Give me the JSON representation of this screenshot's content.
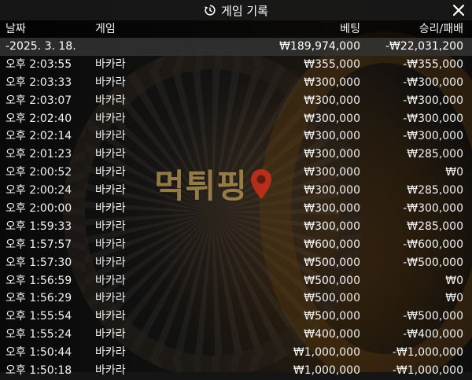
{
  "header": {
    "title": "게임 기록",
    "close_label": "✕"
  },
  "columns": {
    "date": "날짜",
    "game": "게임",
    "bet": "베팅",
    "win_loss": "승리/패배"
  },
  "summary": {
    "date": "-2025. 3. 18.",
    "bet": "₩189,974,000",
    "win_loss": "-₩22,031,200"
  },
  "rows": [
    {
      "time": "오후 2:03:55",
      "game": "바카라",
      "bet": "₩355,000",
      "win_loss": "-₩355,000"
    },
    {
      "time": "오후 2:03:33",
      "game": "바카라",
      "bet": "₩300,000",
      "win_loss": "-₩300,000"
    },
    {
      "time": "오후 2:03:07",
      "game": "바카라",
      "bet": "₩300,000",
      "win_loss": "-₩300,000"
    },
    {
      "time": "오후 2:02:40",
      "game": "바카라",
      "bet": "₩300,000",
      "win_loss": "-₩300,000"
    },
    {
      "time": "오후 2:02:14",
      "game": "바카라",
      "bet": "₩300,000",
      "win_loss": "-₩300,000"
    },
    {
      "time": "오후 2:01:23",
      "game": "바카라",
      "bet": "₩300,000",
      "win_loss": "₩285,000"
    },
    {
      "time": "오후 2:00:52",
      "game": "바카라",
      "bet": "₩300,000",
      "win_loss": "₩0"
    },
    {
      "time": "오후 2:00:24",
      "game": "바카라",
      "bet": "₩300,000",
      "win_loss": "₩285,000"
    },
    {
      "time": "오후 2:00:00",
      "game": "바카라",
      "bet": "₩300,000",
      "win_loss": "-₩300,000"
    },
    {
      "time": "오후 1:59:33",
      "game": "바카라",
      "bet": "₩300,000",
      "win_loss": "₩285,000"
    },
    {
      "time": "오후 1:57:57",
      "game": "바카라",
      "bet": "₩600,000",
      "win_loss": "-₩600,000"
    },
    {
      "time": "오후 1:57:30",
      "game": "바카라",
      "bet": "₩500,000",
      "win_loss": "-₩500,000"
    },
    {
      "time": "오후 1:56:59",
      "game": "바카라",
      "bet": "₩500,000",
      "win_loss": "₩0"
    },
    {
      "time": "오후 1:56:29",
      "game": "바카라",
      "bet": "₩500,000",
      "win_loss": "₩0"
    },
    {
      "time": "오후 1:55:54",
      "game": "바카라",
      "bet": "₩500,000",
      "win_loss": "-₩500,000"
    },
    {
      "time": "오후 1:55:24",
      "game": "바카라",
      "bet": "₩400,000",
      "win_loss": "-₩400,000"
    },
    {
      "time": "오후 1:50:44",
      "game": "바카라",
      "bet": "₩1,000,000",
      "win_loss": "-₩1,000,000"
    },
    {
      "time": "오후 1:50:18",
      "game": "바카라",
      "bet": "₩1,000,000",
      "win_loss": "-₩1,000,000"
    }
  ],
  "watermark": {
    "text": "먹튀핑",
    "color": "#ffd278",
    "pin_color": "#e0301e"
  },
  "icons": {
    "history": "history-icon",
    "close": "close-icon",
    "pin": "map-pin-icon"
  }
}
